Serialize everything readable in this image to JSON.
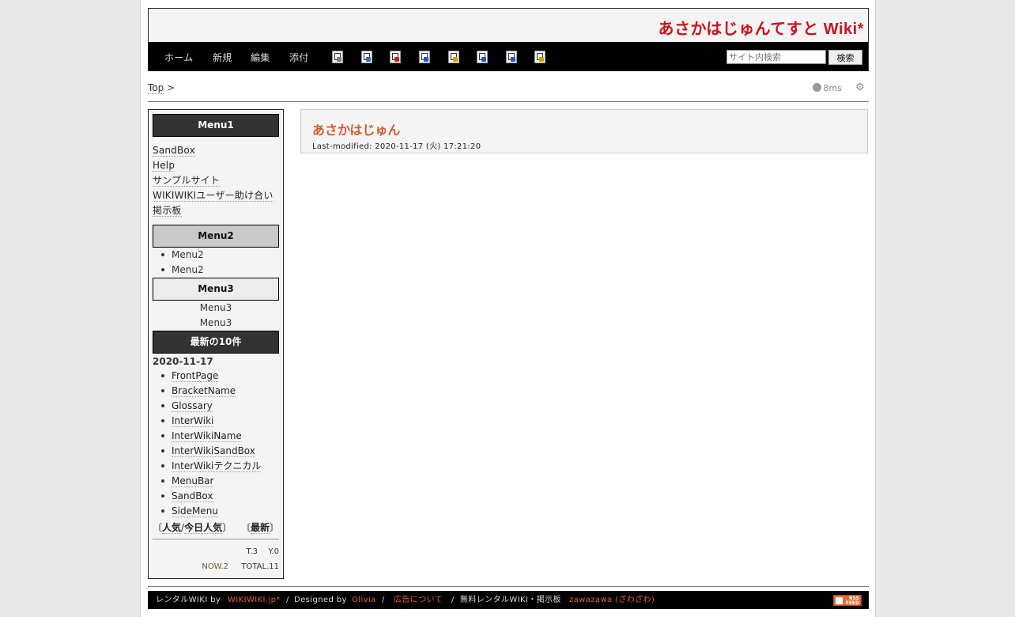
{
  "header": {
    "site_title": "あさかはじゅんてすと Wiki*"
  },
  "nav": {
    "links": [
      "ホーム",
      "新規",
      "編集",
      "添付"
    ],
    "tool_icons": [
      {
        "icon": "copy-page-icon",
        "mark": "#7a7a7a"
      },
      {
        "icon": "diff-page-icon",
        "mark": "#3a6fb0"
      },
      {
        "icon": "backup-icon",
        "mark": "#c02020"
      },
      {
        "icon": "reload-icon",
        "mark": "#2a55c0"
      },
      {
        "icon": "freeze-icon",
        "mark": "#d4a000"
      },
      {
        "icon": "page-list-icon",
        "mark": "#2a55c0"
      },
      {
        "icon": "recent-changes-icon",
        "mark": "#2a55c0"
      },
      {
        "icon": "help-icon",
        "mark": "#d4a000"
      }
    ],
    "search_placeholder": "サイト内検索",
    "search_button": "検索"
  },
  "topicpath": {
    "top": "Top",
    "separator": ">",
    "load_time": "8ms"
  },
  "sidebar": {
    "menu1": {
      "title": "Menu1",
      "links": [
        "SandBox",
        "Help",
        "サンプルサイト",
        "WIKIWIKIユーザー助け合い",
        "掲示板"
      ]
    },
    "menu2": {
      "title": "Menu2",
      "items": [
        "Menu2",
        "Menu2"
      ]
    },
    "menu3": {
      "title": "Menu3",
      "items": [
        "Menu3",
        "Menu3"
      ]
    },
    "recent": {
      "title": "最新の10件",
      "date": "2020-11-17",
      "items": [
        "FrontPage",
        "BracketName",
        "Glossary",
        "InterWiki",
        "InterWikiName",
        "InterWikiSandBox",
        "InterWikiテクニカル",
        "MenuBar",
        "SandBox",
        "SideMenu"
      ],
      "popular_open": "〔",
      "popular": "人気",
      "slash": "/",
      "today_popular": "今日人気",
      "popular_close": "〕",
      "latest_open": "〔",
      "latest": "最新",
      "latest_close": "〕"
    },
    "counter": {
      "today": "T.3",
      "yesterday": "Y.0",
      "now": "NOW.2",
      "total": "TOTAL.11"
    }
  },
  "content": {
    "title": "あさかはじゅん",
    "last_modified": "Last-modified: 2020-11-17 (火) 17:21:20"
  },
  "footer": {
    "rental_label": "レンタルWIKI by",
    "rental_link": "WIKIWIKI.jp*",
    "sep1": "/",
    "designed_label": "Designed by",
    "designer_link": "Olivia",
    "sep2": "/",
    "ad_link": "広告について",
    "sep3": "/",
    "bbs_label": "無料レンタルWIKI・掲示板",
    "bbs_link": "zawazawa (ざわざわ)",
    "rss_line1": "RSS",
    "rss_line2": "FEED"
  }
}
